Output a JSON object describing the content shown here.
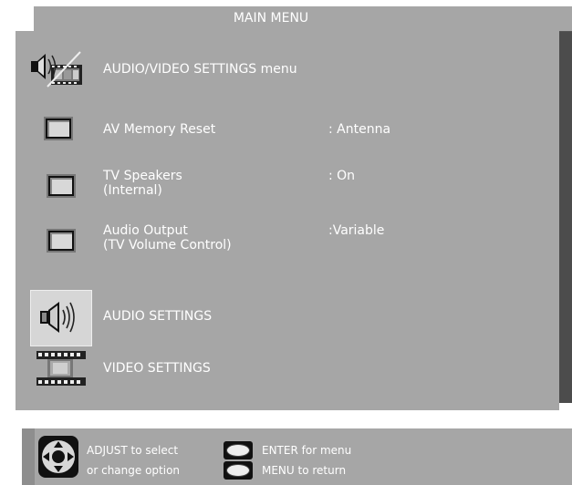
{
  "menu": {
    "title": "MAIN MENU",
    "header_label": "AUDIO/VIDEO SETTINGS menu",
    "items": [
      {
        "label": "AV Memory Reset",
        "sublabel": "",
        "value": ": Antenna"
      },
      {
        "label": "TV Speakers",
        "sublabel": "(Internal)",
        "value": ": On"
      },
      {
        "label": "Audio Output",
        "sublabel": "(TV Volume Control)",
        "value": ":Variable"
      }
    ],
    "sections": [
      {
        "label": "AUDIO SETTINGS",
        "icon": "speaker-icon",
        "selected": true
      },
      {
        "label": "VIDEO SETTINGS",
        "icon": "film-strip-icon",
        "selected": false
      }
    ]
  },
  "footer": {
    "adjust_line1": "ADJUST to select",
    "adjust_line2": "or  change option",
    "enter_label": "ENTER for menu",
    "menu_label": "MENU  to  return"
  },
  "colors": {
    "panel": "#a6a6a6",
    "shadow": "#4c4c4c",
    "text": "#ffffff"
  }
}
